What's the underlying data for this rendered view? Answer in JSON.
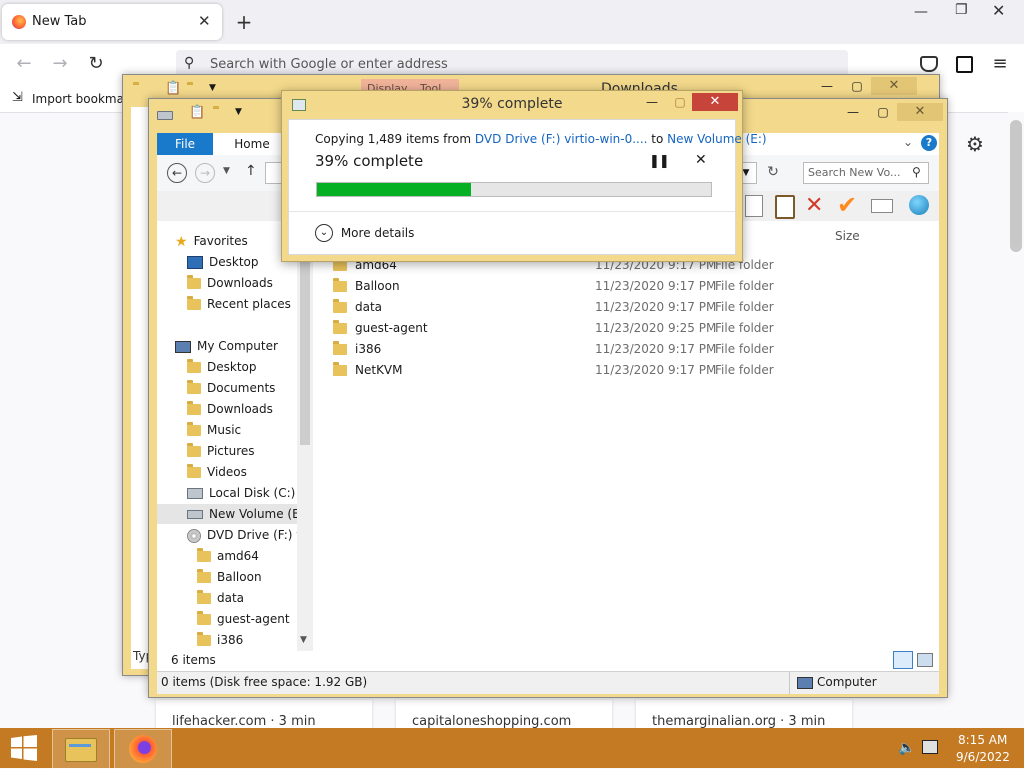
{
  "browser": {
    "tab_title": "New Tab",
    "url_placeholder": "Search with Google or enter address",
    "bookmarks_import": "Import bookmark",
    "cards": [
      "lifehacker.com · 3 min",
      "capitaloneshopping.com",
      "themarginalian.org · 3 min"
    ]
  },
  "explorer_back": {
    "title": "Downloads",
    "tab_hint": "Display... Tool"
  },
  "explorer": {
    "tabs": {
      "file": "File",
      "home": "Home"
    },
    "search_placeholder": "Search New Vo...",
    "column_size": "Size",
    "nav": {
      "favorites_header": "Favorites",
      "favorites": [
        "Desktop",
        "Downloads",
        "Recent places"
      ],
      "computer_header": "My Computer",
      "computer": [
        "Desktop",
        "Documents",
        "Downloads",
        "Music",
        "Pictures",
        "Videos",
        "Local Disk (C:)",
        "New Volume (E:)",
        "DVD Drive (F:) vir"
      ],
      "dvd_children": [
        "amd64",
        "Balloon",
        "data",
        "guest-agent",
        "i386"
      ]
    },
    "files": [
      {
        "name": "amd64",
        "date": "11/23/2020 9:17 PM",
        "type": "File folder"
      },
      {
        "name": "Balloon",
        "date": "11/23/2020 9:17 PM",
        "type": "File folder"
      },
      {
        "name": "data",
        "date": "11/23/2020 9:17 PM",
        "type": "File folder"
      },
      {
        "name": "guest-agent",
        "date": "11/23/2020 9:25 PM",
        "type": "File folder"
      },
      {
        "name": "i386",
        "date": "11/23/2020 9:17 PM",
        "type": "File folder"
      },
      {
        "name": "NetKVM",
        "date": "11/23/2020 9:17 PM",
        "type": "File folder"
      }
    ],
    "item_count": "6 items",
    "status_left": "0 items (Disk free space: 1.92 GB)",
    "status_right": "Computer",
    "back_status_partial": "Typ"
  },
  "copy_dialog": {
    "title": "39% complete",
    "copy_prefix": "Copying 1,489 items from ",
    "source": "DVD Drive (F:) virtio-win-0....",
    "to_word": " to ",
    "dest": "New Volume (E:)",
    "percent_text": "39% complete",
    "progress": 0.39,
    "more_details": "More details"
  },
  "taskbar": {
    "time": "8:15 AM",
    "date": "9/6/2022"
  },
  "colors": {
    "accent_blue": "#1979ca",
    "progress_green": "#06b025",
    "window_frame": "#f3d98b",
    "taskbar": "#c47a22"
  }
}
